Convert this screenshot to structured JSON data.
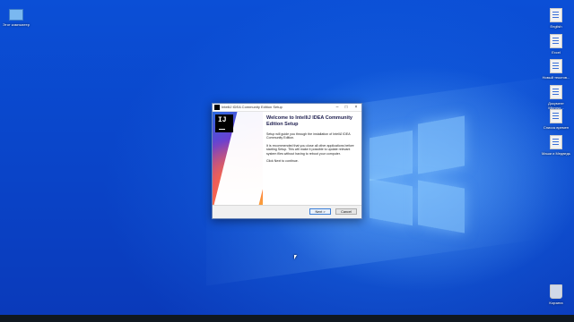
{
  "desktop": {
    "left_icons": [
      {
        "label": "Этот компьютер",
        "icon": "computer-icon"
      }
    ],
    "right_icons": [
      {
        "label": "English",
        "icon": "document-icon"
      },
      {
        "label": "Excel",
        "icon": "document-icon"
      },
      {
        "label": "Новый текстов...",
        "icon": "document-icon"
      },
      {
        "label": "Документ Microso...",
        "icon": "document-icon"
      },
      {
        "label": "Список времен",
        "icon": "document-icon"
      },
      {
        "label": "Маши и Медведь",
        "icon": "document-icon"
      },
      {
        "label": "Корзина",
        "icon": "recycle-bin-icon"
      }
    ]
  },
  "window": {
    "title": "IntelliJ IDEA Community Edition Setup",
    "logo_text": "IJ",
    "heading": "Welcome to IntelliJ IDEA Community Edition Setup",
    "paragraphs": [
      "Setup will guide you through the installation of IntelliJ IDEA Community Edition.",
      "It is recommended that you close all other applications before starting Setup. This will make it possible to update relevant system files without having to reboot your computer.",
      "Click Next to continue."
    ],
    "buttons": {
      "next": "Next >",
      "cancel": "Cancel"
    },
    "controls": {
      "minimize": "–",
      "maximize": "□",
      "close": "×"
    }
  },
  "colors": {
    "desktop_blue": "#0a44c8",
    "accent_button": "#3c7fd8",
    "heading": "#1f1f4f"
  }
}
